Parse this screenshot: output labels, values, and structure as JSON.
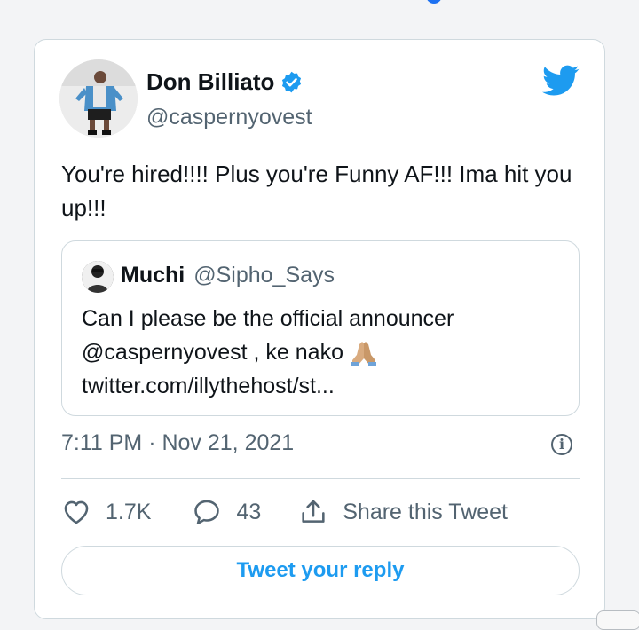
{
  "tweet": {
    "author_name": "Don Billiato",
    "author_handle": "@caspernyovest",
    "text": "You're hired!!!! Plus you're Funny AF!!! Ima hit you up!!!",
    "timestamp": "7:11 PM · Nov 21, 2021",
    "likes": "1.7K",
    "replies": "43",
    "share_label": "Share this Tweet",
    "reply_button_label": "Tweet your reply",
    "info_glyph": "i"
  },
  "quote": {
    "author_name": "Muchi",
    "author_handle": "@Sipho_Says",
    "text_line1": "Can I please be the official announcer",
    "text_line2": "@caspernyovest , ke nako",
    "text_line3": "twitter.com/illythehost/st..."
  },
  "colors": {
    "accent": "#1d9bf0",
    "verified": "#1d9bf0",
    "muted": "#536471",
    "border": "#cfd9de"
  },
  "icons": [
    "verified-badge-icon",
    "twitter-bird-icon",
    "heart-icon",
    "comment-icon",
    "share-icon",
    "info-icon",
    "folded-hands-emoji"
  ]
}
